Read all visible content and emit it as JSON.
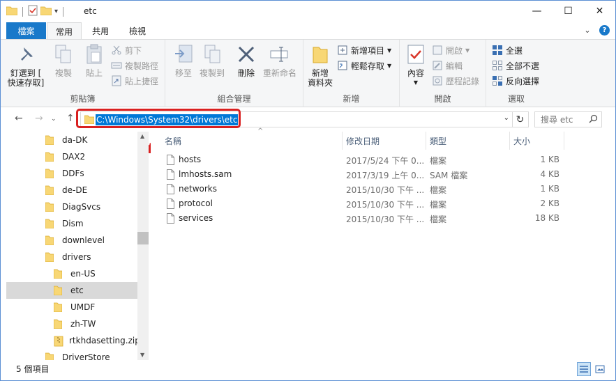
{
  "window": {
    "title": "etc",
    "controls": {
      "minimize": "—",
      "maximize": "☐",
      "close": "✕"
    }
  },
  "qat": {
    "dropdown": "▾"
  },
  "tabs": {
    "file": "檔案",
    "home": "常用",
    "share": "共用",
    "view": "檢視"
  },
  "ribbon_ctrl": {
    "collapse": "⌄",
    "help": "?"
  },
  "ribbon": {
    "clipboard": {
      "label": "剪貼簿",
      "pin": "釘選到 [\n快速存取]",
      "copy": "複製",
      "paste": "貼上",
      "cut": "剪下",
      "copy_path": "複製路徑",
      "paste_shortcut": "貼上捷徑"
    },
    "organize": {
      "label": "組合管理",
      "move_to": "移至",
      "copy_to": "複製到",
      "delete": "刪除",
      "rename": "重新命名"
    },
    "new": {
      "label": "新增",
      "new_folder": "新增\n資料夾",
      "new_item": "新增項目",
      "easy_access": "輕鬆存取"
    },
    "open": {
      "label": "開啟",
      "properties": "內容",
      "open": "開啟",
      "edit": "編輯",
      "history": "歷程記錄"
    },
    "select": {
      "label": "選取",
      "select_all": "全選",
      "select_none": "全部不選",
      "invert": "反向選擇"
    }
  },
  "address": {
    "path": "C:\\Windows\\System32\\drivers\\etc"
  },
  "search": {
    "placeholder": "搜尋 etc"
  },
  "nav": [
    {
      "label": "da-DK",
      "level": 1,
      "type": "folder"
    },
    {
      "label": "DAX2",
      "level": 1,
      "type": "folder"
    },
    {
      "label": "DDFs",
      "level": 1,
      "type": "folder"
    },
    {
      "label": "de-DE",
      "level": 1,
      "type": "folder"
    },
    {
      "label": "DiagSvcs",
      "level": 1,
      "type": "folder"
    },
    {
      "label": "Dism",
      "level": 1,
      "type": "folder"
    },
    {
      "label": "downlevel",
      "level": 1,
      "type": "folder"
    },
    {
      "label": "drivers",
      "level": 1,
      "type": "folder"
    },
    {
      "label": "en-US",
      "level": 2,
      "type": "folder"
    },
    {
      "label": "etc",
      "level": 2,
      "type": "folder",
      "selected": true
    },
    {
      "label": "UMDF",
      "level": 2,
      "type": "folder"
    },
    {
      "label": "zh-TW",
      "level": 2,
      "type": "folder"
    },
    {
      "label": "rtkhdasetting.zip",
      "level": 2,
      "type": "zip"
    },
    {
      "label": "DriverStore",
      "level": 1,
      "type": "folder"
    }
  ],
  "columns": {
    "name": "名稱",
    "date": "修改日期",
    "type": "類型",
    "size": "大小"
  },
  "files": [
    {
      "name": "hosts",
      "date": "2017/5/24 下午 0...",
      "type": "檔案",
      "size": "1 KB"
    },
    {
      "name": "lmhosts.sam",
      "date": "2017/3/19 上午 0...",
      "type": "SAM 檔案",
      "size": "4 KB"
    },
    {
      "name": "networks",
      "date": "2015/10/30 下午 ...",
      "type": "檔案",
      "size": "1 KB"
    },
    {
      "name": "protocol",
      "date": "2015/10/30 下午 ...",
      "type": "檔案",
      "size": "2 KB"
    },
    {
      "name": "services",
      "date": "2015/10/30 下午 ...",
      "type": "檔案",
      "size": "18 KB"
    }
  ],
  "status": {
    "count": "5 個項目"
  },
  "colors": {
    "accent": "#1979ca",
    "selection": "#0078d7",
    "highlight": "#d92020",
    "folder": "#f8d775"
  }
}
